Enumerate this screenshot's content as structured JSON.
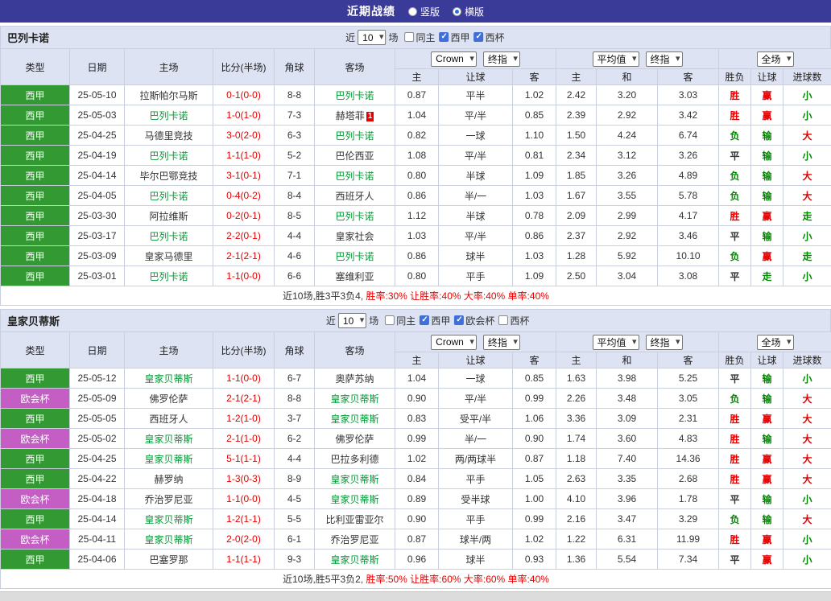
{
  "colors": {
    "topbar_bg": "#3a3a99",
    "panel_bg": "#dde3f2",
    "border": "#c9cfdf",
    "liga_bg": "#339933",
    "conf_bg": "#c45ec4",
    "red": "#e60000",
    "green": "#008800",
    "dark": "#333333",
    "team_green": "#009933",
    "result_map": {
      "胜": "red",
      "平": "dark",
      "负": "green",
      "赢": "red",
      "输": "green",
      "走": "green",
      "大": "red",
      "小": "green"
    }
  },
  "topbar": {
    "title": "近期战绩",
    "radios": [
      {
        "label": "竖版",
        "selected": false
      },
      {
        "label": "横版",
        "selected": true
      }
    ]
  },
  "labels": {
    "near": "近",
    "games": "场"
  },
  "table_header": {
    "col_type": "类型",
    "col_date": "日期",
    "col_home": "主场",
    "col_score": "比分(半场)",
    "col_corner": "角球",
    "col_away": "客场",
    "odds_source_select": "Crown",
    "odds_stage_select": "终指",
    "average_select": "平均值",
    "average_stage_select": "终指",
    "fullmatch_select": "全场",
    "col_h": "主",
    "col_handicap": "让球",
    "col_a": "客",
    "col_avg_h": "主",
    "col_avg_d": "和",
    "col_avg_a": "客",
    "col_result": "胜负",
    "col_handicap_result": "让球",
    "col_goals": "进球数"
  },
  "sections": [
    {
      "team": "巴列卡诺",
      "recent_count": "10",
      "checkboxes": [
        {
          "label": "同主",
          "checked": false
        },
        {
          "label": "西甲",
          "checked": true
        },
        {
          "label": "西杯",
          "checked": true
        }
      ],
      "rows": [
        {
          "league": "西甲",
          "lc": "liga",
          "date": "25-05-10",
          "home": "拉斯帕尔马斯",
          "hf": false,
          "score": "0-1(0-0)",
          "corner": "8-8",
          "away": "巴列卡诺",
          "af": true,
          "badge": "",
          "h": "0.87",
          "hd": "平半",
          "a": "1.02",
          "eh": "2.42",
          "ed": "3.20",
          "ea": "3.03",
          "res": "胜",
          "hres": "赢",
          "goal": "小"
        },
        {
          "league": "西甲",
          "lc": "liga",
          "date": "25-05-03",
          "home": "巴列卡诺",
          "hf": true,
          "score": "1-0(1-0)",
          "corner": "7-3",
          "away": "赫塔菲",
          "af": false,
          "badge": "1",
          "h": "1.04",
          "hd": "平/半",
          "a": "0.85",
          "eh": "2.39",
          "ed": "2.92",
          "ea": "3.42",
          "res": "胜",
          "hres": "赢",
          "goal": "小"
        },
        {
          "league": "西甲",
          "lc": "liga",
          "date": "25-04-25",
          "home": "马德里竞技",
          "hf": false,
          "score": "3-0(2-0)",
          "corner": "6-3",
          "away": "巴列卡诺",
          "af": true,
          "badge": "",
          "h": "0.82",
          "hd": "一球",
          "a": "1.10",
          "eh": "1.50",
          "ed": "4.24",
          "ea": "6.74",
          "res": "负",
          "hres": "输",
          "goal": "大"
        },
        {
          "league": "西甲",
          "lc": "liga",
          "date": "25-04-19",
          "home": "巴列卡诺",
          "hf": true,
          "score": "1-1(1-0)",
          "corner": "5-2",
          "away": "巴伦西亚",
          "af": false,
          "badge": "",
          "h": "1.08",
          "hd": "平/半",
          "a": "0.81",
          "eh": "2.34",
          "ed": "3.12",
          "ea": "3.26",
          "res": "平",
          "hres": "输",
          "goal": "小"
        },
        {
          "league": "西甲",
          "lc": "liga",
          "date": "25-04-14",
          "home": "毕尔巴鄂竞技",
          "hf": false,
          "score": "3-1(0-1)",
          "corner": "7-1",
          "away": "巴列卡诺",
          "af": true,
          "badge": "",
          "h": "0.80",
          "hd": "半球",
          "a": "1.09",
          "eh": "1.85",
          "ed": "3.26",
          "ea": "4.89",
          "res": "负",
          "hres": "输",
          "goal": "大"
        },
        {
          "league": "西甲",
          "lc": "liga",
          "date": "25-04-05",
          "home": "巴列卡诺",
          "hf": true,
          "score": "0-4(0-2)",
          "corner": "8-4",
          "away": "西班牙人",
          "af": false,
          "badge": "",
          "h": "0.86",
          "hd": "半/一",
          "a": "1.03",
          "eh": "1.67",
          "ed": "3.55",
          "ea": "5.78",
          "res": "负",
          "hres": "输",
          "goal": "大"
        },
        {
          "league": "西甲",
          "lc": "liga",
          "date": "25-03-30",
          "home": "阿拉维斯",
          "hf": false,
          "score": "0-2(0-1)",
          "corner": "8-5",
          "away": "巴列卡诺",
          "af": true,
          "badge": "",
          "h": "1.12",
          "hd": "半球",
          "a": "0.78",
          "eh": "2.09",
          "ed": "2.99",
          "ea": "4.17",
          "res": "胜",
          "hres": "赢",
          "goal": "走"
        },
        {
          "league": "西甲",
          "lc": "liga",
          "date": "25-03-17",
          "home": "巴列卡诺",
          "hf": true,
          "score": "2-2(0-1)",
          "corner": "4-4",
          "away": "皇家社会",
          "af": false,
          "badge": "",
          "h": "1.03",
          "hd": "平/半",
          "a": "0.86",
          "eh": "2.37",
          "ed": "2.92",
          "ea": "3.46",
          "res": "平",
          "hres": "输",
          "goal": "小"
        },
        {
          "league": "西甲",
          "lc": "liga",
          "date": "25-03-09",
          "home": "皇家马德里",
          "hf": false,
          "score": "2-1(2-1)",
          "corner": "4-6",
          "away": "巴列卡诺",
          "af": true,
          "badge": "",
          "h": "0.86",
          "hd": "球半",
          "a": "1.03",
          "eh": "1.28",
          "ed": "5.92",
          "ea": "10.10",
          "res": "负",
          "hres": "赢",
          "goal": "走"
        },
        {
          "league": "西甲",
          "lc": "liga",
          "date": "25-03-01",
          "home": "巴列卡诺",
          "hf": true,
          "score": "1-1(0-0)",
          "corner": "6-6",
          "away": "塞维利亚",
          "af": false,
          "badge": "",
          "h": "0.80",
          "hd": "平手",
          "a": "1.09",
          "eh": "2.50",
          "ed": "3.04",
          "ea": "3.08",
          "res": "平",
          "hres": "走",
          "goal": "小"
        }
      ],
      "summary": {
        "prefix": "近10场,胜3平3负4, ",
        "stats": "胜率:30% 让胜率:40% 大率:40% 单率:40%"
      }
    },
    {
      "team": "皇家贝蒂斯",
      "recent_count": "10",
      "checkboxes": [
        {
          "label": "同主",
          "checked": false
        },
        {
          "label": "西甲",
          "checked": true
        },
        {
          "label": "欧会杯",
          "checked": true
        },
        {
          "label": "西杯",
          "checked": false
        }
      ],
      "rows": [
        {
          "league": "西甲",
          "lc": "liga",
          "date": "25-05-12",
          "home": "皇家贝蒂斯",
          "hf": true,
          "score": "1-1(0-0)",
          "corner": "6-7",
          "away": "奥萨苏纳",
          "af": false,
          "badge": "",
          "h": "1.04",
          "hd": "一球",
          "a": "0.85",
          "eh": "1.63",
          "ed": "3.98",
          "ea": "5.25",
          "res": "平",
          "hres": "输",
          "goal": "小"
        },
        {
          "league": "欧会杯",
          "lc": "conf",
          "date": "25-05-09",
          "home": "佛罗伦萨",
          "hf": false,
          "score": "2-1(2-1)",
          "corner": "8-8",
          "away": "皇家贝蒂斯",
          "af": true,
          "badge": "",
          "h": "0.90",
          "hd": "平/半",
          "a": "0.99",
          "eh": "2.26",
          "ed": "3.48",
          "ea": "3.05",
          "res": "负",
          "hres": "输",
          "goal": "大"
        },
        {
          "league": "西甲",
          "lc": "liga",
          "date": "25-05-05",
          "home": "西班牙人",
          "hf": false,
          "score": "1-2(1-0)",
          "corner": "3-7",
          "away": "皇家贝蒂斯",
          "af": true,
          "badge": "",
          "h": "0.83",
          "hd": "受平/半",
          "a": "1.06",
          "eh": "3.36",
          "ed": "3.09",
          "ea": "2.31",
          "res": "胜",
          "hres": "赢",
          "goal": "大"
        },
        {
          "league": "欧会杯",
          "lc": "conf",
          "date": "25-05-02",
          "home": "皇家贝蒂斯",
          "hf": true,
          "score": "2-1(1-0)",
          "corner": "6-2",
          "away": "佛罗伦萨",
          "af": false,
          "badge": "",
          "h": "0.99",
          "hd": "半/一",
          "a": "0.90",
          "eh": "1.74",
          "ed": "3.60",
          "ea": "4.83",
          "res": "胜",
          "hres": "输",
          "goal": "大"
        },
        {
          "league": "西甲",
          "lc": "liga",
          "date": "25-04-25",
          "home": "皇家贝蒂斯",
          "hf": true,
          "score": "5-1(1-1)",
          "corner": "4-4",
          "away": "巴拉多利德",
          "af": false,
          "badge": "",
          "h": "1.02",
          "hd": "两/两球半",
          "a": "0.87",
          "eh": "1.18",
          "ed": "7.40",
          "ea": "14.36",
          "res": "胜",
          "hres": "赢",
          "goal": "大"
        },
        {
          "league": "西甲",
          "lc": "liga",
          "date": "25-04-22",
          "home": "赫罗纳",
          "hf": false,
          "score": "1-3(0-3)",
          "corner": "8-9",
          "away": "皇家贝蒂斯",
          "af": true,
          "badge": "",
          "h": "0.84",
          "hd": "平手",
          "a": "1.05",
          "eh": "2.63",
          "ed": "3.35",
          "ea": "2.68",
          "res": "胜",
          "hres": "赢",
          "goal": "大"
        },
        {
          "league": "欧会杯",
          "lc": "conf",
          "date": "25-04-18",
          "home": "乔治罗尼亚",
          "hf": false,
          "score": "1-1(0-0)",
          "corner": "4-5",
          "away": "皇家贝蒂斯",
          "af": true,
          "badge": "",
          "h": "0.89",
          "hd": "受半球",
          "a": "1.00",
          "eh": "4.10",
          "ed": "3.96",
          "ea": "1.78",
          "res": "平",
          "hres": "输",
          "goal": "小"
        },
        {
          "league": "西甲",
          "lc": "liga",
          "date": "25-04-14",
          "home": "皇家贝蒂斯",
          "hf": true,
          "score": "1-2(1-1)",
          "corner": "5-5",
          "away": "比利亚雷亚尔",
          "af": false,
          "badge": "",
          "h": "0.90",
          "hd": "平手",
          "a": "0.99",
          "eh": "2.16",
          "ed": "3.47",
          "ea": "3.29",
          "res": "负",
          "hres": "输",
          "goal": "大"
        },
        {
          "league": "欧会杯",
          "lc": "conf",
          "date": "25-04-11",
          "home": "皇家贝蒂斯",
          "hf": true,
          "score": "2-0(2-0)",
          "corner": "6-1",
          "away": "乔治罗尼亚",
          "af": false,
          "badge": "",
          "h": "0.87",
          "hd": "球半/两",
          "a": "1.02",
          "eh": "1.22",
          "ed": "6.31",
          "ea": "11.99",
          "res": "胜",
          "hres": "赢",
          "goal": "小"
        },
        {
          "league": "西甲",
          "lc": "liga",
          "date": "25-04-06",
          "home": "巴塞罗那",
          "hf": false,
          "score": "1-1(1-1)",
          "corner": "9-3",
          "away": "皇家贝蒂斯",
          "af": true,
          "badge": "",
          "h": "0.96",
          "hd": "球半",
          "a": "0.93",
          "eh": "1.36",
          "ed": "5.54",
          "ea": "7.34",
          "res": "平",
          "hres": "赢",
          "goal": "小"
        }
      ],
      "summary": {
        "prefix": "近10场,胜5平3负2, ",
        "stats": "胜率:50% 让胜率:60% 大率:60% 单率:40%"
      }
    }
  ]
}
